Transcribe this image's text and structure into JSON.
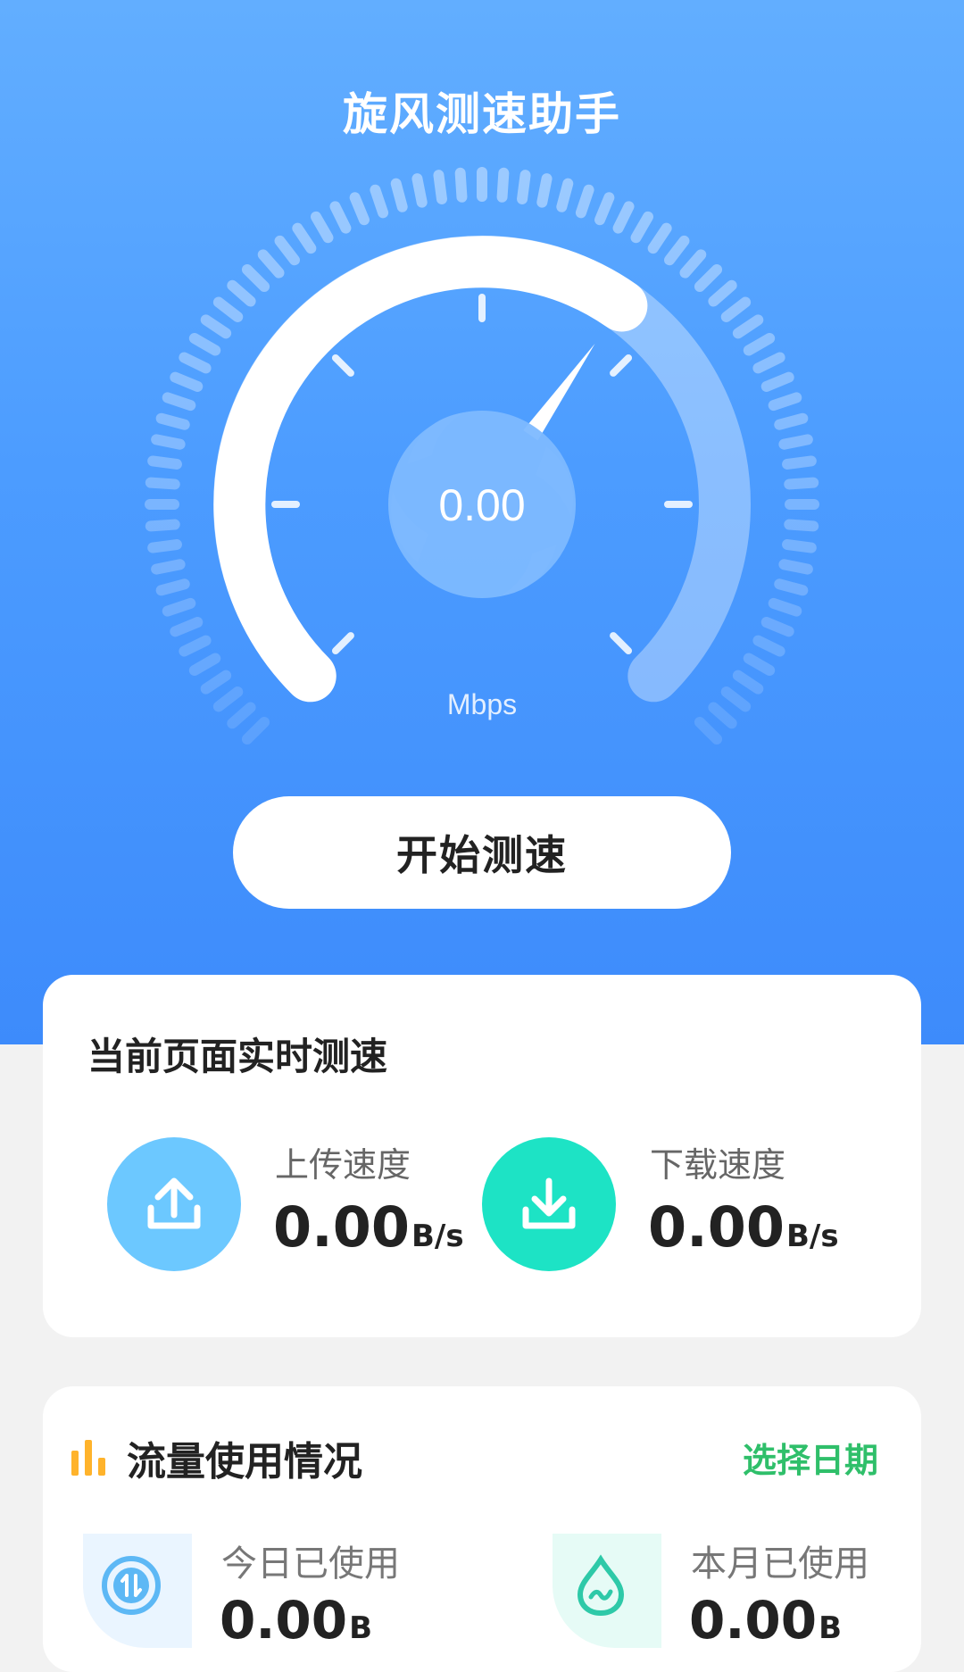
{
  "header": {
    "title": "旋风测速助手"
  },
  "gauge": {
    "value": "0.00",
    "unit": "Mbps",
    "needle_level": 0.63
  },
  "start_button": {
    "label": "开始测速"
  },
  "realtime": {
    "title": "当前页面实时测速",
    "upload": {
      "label": "上传速度",
      "value": "0.00",
      "unit": "B/s",
      "color": "#6cc8ff"
    },
    "download": {
      "label": "下载速度",
      "value": "0.00",
      "unit": "B/s",
      "color": "#1de3c5"
    }
  },
  "traffic": {
    "title": "流量使用情况",
    "select_date": "选择日期",
    "today": {
      "label": "今日已使用",
      "value": "0.00",
      "unit": "B"
    },
    "month": {
      "label": "本月已使用",
      "value": "0.00",
      "unit": "B"
    }
  },
  "colors": {
    "accent_blue": "#4c9cff",
    "select_date_green": "#2fbf6a",
    "chart_icon_orange": "#ffb32b"
  }
}
